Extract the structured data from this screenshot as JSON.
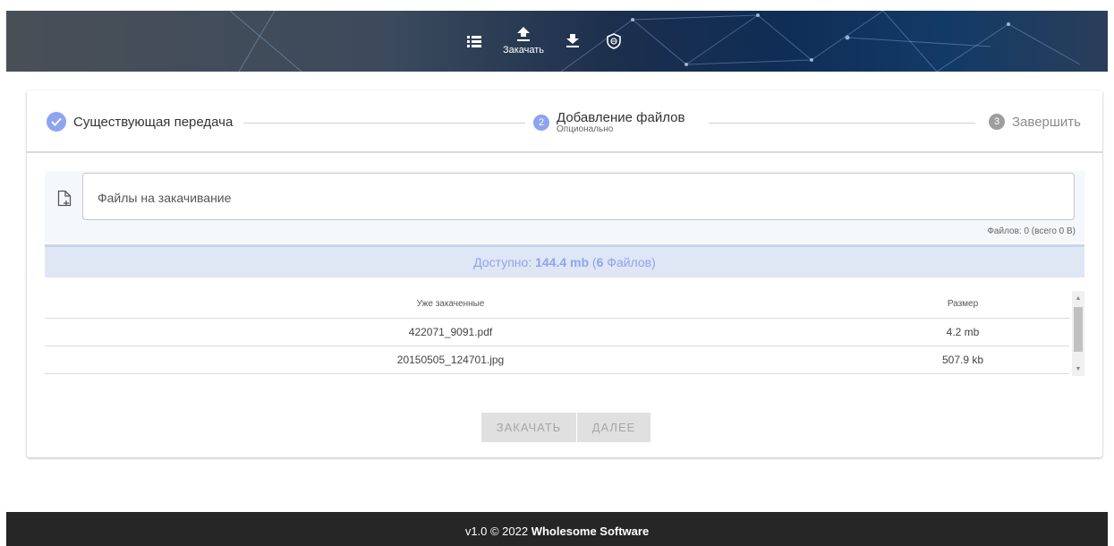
{
  "header": {
    "nav": [
      {
        "icon": "list-icon",
        "label": ""
      },
      {
        "icon": "upload-icon",
        "label": "Закачать"
      },
      {
        "icon": "download-icon",
        "label": ""
      },
      {
        "icon": "shield-icon",
        "label": ""
      }
    ]
  },
  "stepper": {
    "steps": [
      {
        "number": "",
        "title": "Существующая передача",
        "subtitle": "",
        "state": "done"
      },
      {
        "number": "2",
        "title": "Добавление файлов",
        "subtitle": "Опционально",
        "state": "active"
      },
      {
        "number": "3",
        "title": "Завершить",
        "subtitle": "",
        "state": "idle"
      }
    ]
  },
  "upload": {
    "placeholder": "Файлы на закачивание",
    "files_count": "Файлов: 0 (всего 0 B)"
  },
  "available": {
    "prefix": "Доступно: ",
    "size": "144.4 mb",
    "open_paren": " (",
    "count": "6",
    "suffix": " Файлов)"
  },
  "table": {
    "headers": {
      "name": "Уже закаченные",
      "size": "Размер"
    },
    "rows": [
      {
        "name": "422071_9091.pdf",
        "size": "4.2 mb"
      },
      {
        "name": "20150505_124701.jpg",
        "size": "507.9 kb"
      }
    ]
  },
  "buttons": {
    "upload": "ЗАКАЧАТЬ",
    "next": "ДАЛЕЕ"
  },
  "footer": {
    "prefix": "v1.0 © 2022 ",
    "company": "Wholesome Software"
  },
  "colors": {
    "accent": "#8ea4ee",
    "footer_bg": "#262626",
    "available_bg": "#dfe6f4"
  }
}
